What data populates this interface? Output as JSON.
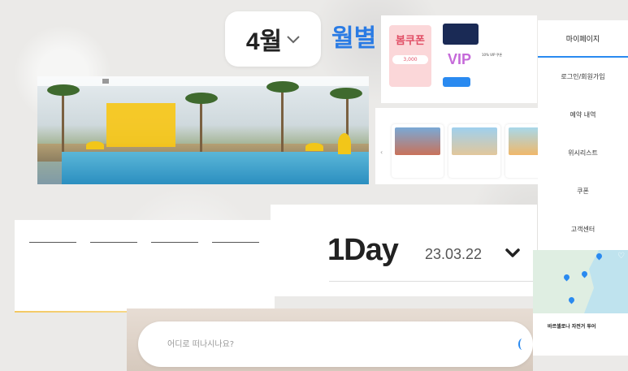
{
  "month_selector": {
    "label": "4월",
    "chevron": "chevron-down-icon"
  },
  "monthly_label": "월별",
  "hero": {
    "nav": [
      "",
      "",
      "",
      ""
    ],
    "card_title": "",
    "card_subtitle": ""
  },
  "coupon": {
    "spring_sub": "",
    "spring_title": "봄쿠폰",
    "spring_amount": "3,000",
    "logo_text": "",
    "vip_text": "VIP",
    "info_top": "",
    "info_bottom": "10% VIP 쿠폰",
    "button": ""
  },
  "recommend": {
    "title_prefix": "",
    "title_rest": "",
    "cards": [
      {
        "name": "",
        "meta": ""
      },
      {
        "name": "",
        "meta": ""
      },
      {
        "name": "",
        "meta": ""
      }
    ]
  },
  "mypage": {
    "title": "마이페이지",
    "items": [
      "로그인/회원가입",
      "예약 내역",
      "위시리스트",
      "쿠폰",
      "고객센터"
    ]
  },
  "footer": {
    "columns": [
      {
        "heading": "",
        "links": [
          "",
          "",
          "",
          ""
        ]
      },
      {
        "heading": "",
        "links": [
          "",
          "",
          "",
          ""
        ]
      },
      {
        "heading": "",
        "links": [
          "",
          "",
          ""
        ]
      },
      {
        "heading": "",
        "links": [
          "",
          "",
          "",
          ""
        ]
      }
    ]
  },
  "day_picker": {
    "mode": "1Day",
    "date": "23.03.22",
    "chevron": "chevron-down-icon"
  },
  "map_card": {
    "title": "바르셀로나 자전거 투어",
    "meta": ""
  },
  "search": {
    "placeholder": "어디로 떠나시나요?"
  },
  "colors": {
    "accent": "#2a8af0",
    "hero_card": "#f7c718",
    "coupon_pink": "#e14e65"
  }
}
